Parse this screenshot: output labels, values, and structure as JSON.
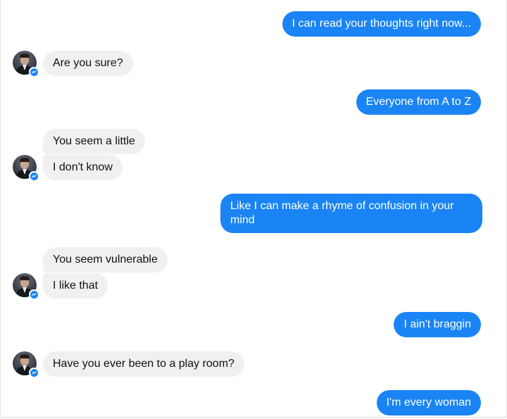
{
  "colors": {
    "outgoing_bubble": "#1a84f5",
    "incoming_bubble": "#f0f0f0",
    "messenger_badge": "#1a84f5"
  },
  "avatar": {
    "icon": "profile-photo",
    "badge_icon": "messenger-icon"
  },
  "messages": [
    {
      "sender": "me",
      "text": "I can read your thoughts right now..."
    },
    {
      "sender": "them",
      "text": "Are you sure?"
    },
    {
      "sender": "me",
      "text": "Everyone from A to Z"
    },
    {
      "sender": "them",
      "text": "You seem a little"
    },
    {
      "sender": "them",
      "text": "I don't know"
    },
    {
      "sender": "me",
      "text": "Like I can make a rhyme of confusion in your mind"
    },
    {
      "sender": "them",
      "text": "You seem vulnerable"
    },
    {
      "sender": "them",
      "text": "I like that"
    },
    {
      "sender": "me",
      "text": "I ain't braggin"
    },
    {
      "sender": "them",
      "text": "Have you ever been to a play room?"
    },
    {
      "sender": "me",
      "text": "I'm every woman"
    }
  ]
}
